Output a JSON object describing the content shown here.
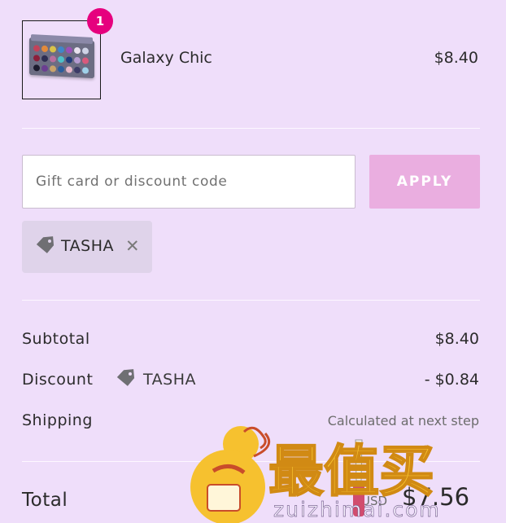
{
  "cart": {
    "quantity_badge": "1",
    "item": {
      "name": "Galaxy Chic",
      "price": "$8.40"
    }
  },
  "discount_form": {
    "placeholder": "Gift card or discount code",
    "apply_label": "APPLY",
    "applied_code": "TASHA"
  },
  "summary": {
    "subtotal_label": "Subtotal",
    "subtotal_value": "$8.40",
    "discount_label": "Discount",
    "discount_code": "TASHA",
    "discount_value": "- $0.84",
    "shipping_label": "Shipping",
    "shipping_value": "Calculated at next step",
    "total_label": "Total",
    "currency": "USD",
    "total_value": "$7.56"
  },
  "watermark": {
    "chinese_text": "最值买",
    "url_text": "zuizhimai.com"
  },
  "colors": {
    "background": "#efdefa",
    "badge": "#e6007e",
    "apply_button": "#eaaee0",
    "chip": "#dfd3ea"
  }
}
